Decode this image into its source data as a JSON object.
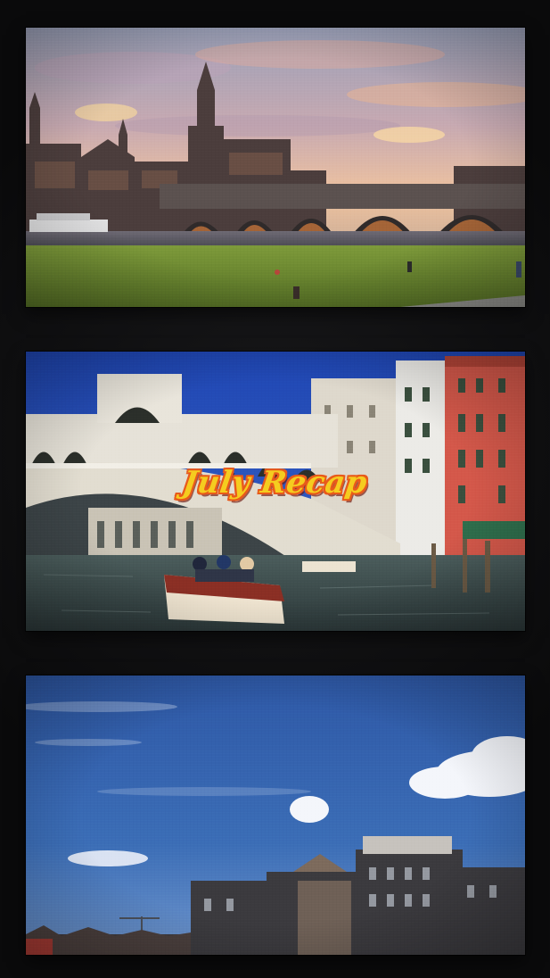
{
  "overlay": {
    "title": "July Recap",
    "title_fill": "#f5cc1f",
    "title_outline": "#e85a1b"
  },
  "panels": [
    {
      "scene": "dresden-riverside-bridge-at-sunset"
    },
    {
      "scene": "venice-rialto-bridge-grand-canal-boat"
    },
    {
      "scene": "amsterdam-rooftops-blue-sky-clouds"
    }
  ],
  "colors": {
    "background": "#0b0b0c",
    "sunset_sky_top": "#a89fb0",
    "sunset_sky_glow": "#efc09c",
    "grass": "#6f8d33",
    "venice_sky": "#2a4fb0",
    "venice_red_building": "#d65a44",
    "canal_water": "#3e4d4f",
    "amsterdam_sky": "#2f5fa8"
  }
}
